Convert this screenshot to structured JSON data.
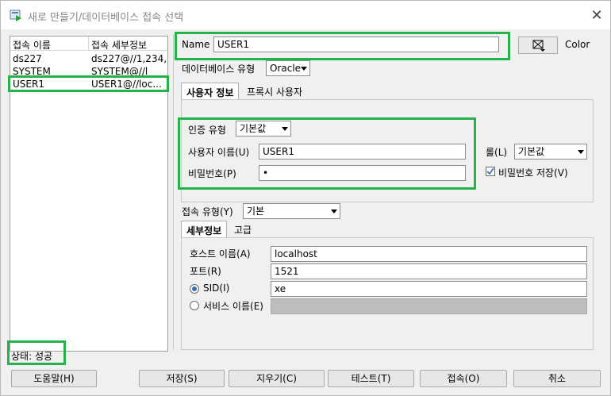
{
  "window": {
    "title": "새로 만들기/데이터베이스 접속 선택",
    "close_glyph": "✕"
  },
  "connections": {
    "headers": [
      "접속 이름",
      "접속 세부정보"
    ],
    "rows": [
      {
        "name": "ds227",
        "detail": "ds227@//1,234,..."
      },
      {
        "name": "SYSTEM",
        "detail": "SYSTEM@//l"
      },
      {
        "name": "USER1",
        "detail": "USER1@//loc...",
        "selected": true
      }
    ]
  },
  "status": "상태: 성공",
  "form": {
    "name_label": "Name",
    "name_value": "USER1",
    "color_label": "Color",
    "db_type_label": "데이터베이스 유형",
    "db_type_value": "Oracle",
    "tabs": {
      "user_info": "사용자 정보",
      "proxy_user": "프록시 사용자"
    },
    "auth_type_label": "인증 유형",
    "auth_type_value": "기본값",
    "username_label": "사용자 이름(U)",
    "username_value": "USER1",
    "password_label": "비밀번호(P)",
    "password_value": "•",
    "role_label": "롤(L)",
    "role_value": "기본값",
    "save_password_label": "비밀번호 저장(V)",
    "save_password_checked": true,
    "conn_type_label": "접속 유형(Y)",
    "conn_type_value": "기본",
    "detail_tabs": {
      "details": "세부정보",
      "advanced": "고급"
    },
    "host_label": "호스트 이름(A)",
    "host_value": "localhost",
    "port_label": "포트(R)",
    "port_value": "1521",
    "sid_label": "SID(I)",
    "sid_value": "xe",
    "service_label": "서비스 이름(E)",
    "service_value": ""
  },
  "buttons": {
    "help": "도움말(H)",
    "save": "저장(S)",
    "clear": "지우기(C)",
    "test": "테스트(T)",
    "connect": "접속(O)",
    "cancel": "취소"
  },
  "colors": {
    "highlight": "#25b24a",
    "radio_accent": "#2f6fbd"
  }
}
